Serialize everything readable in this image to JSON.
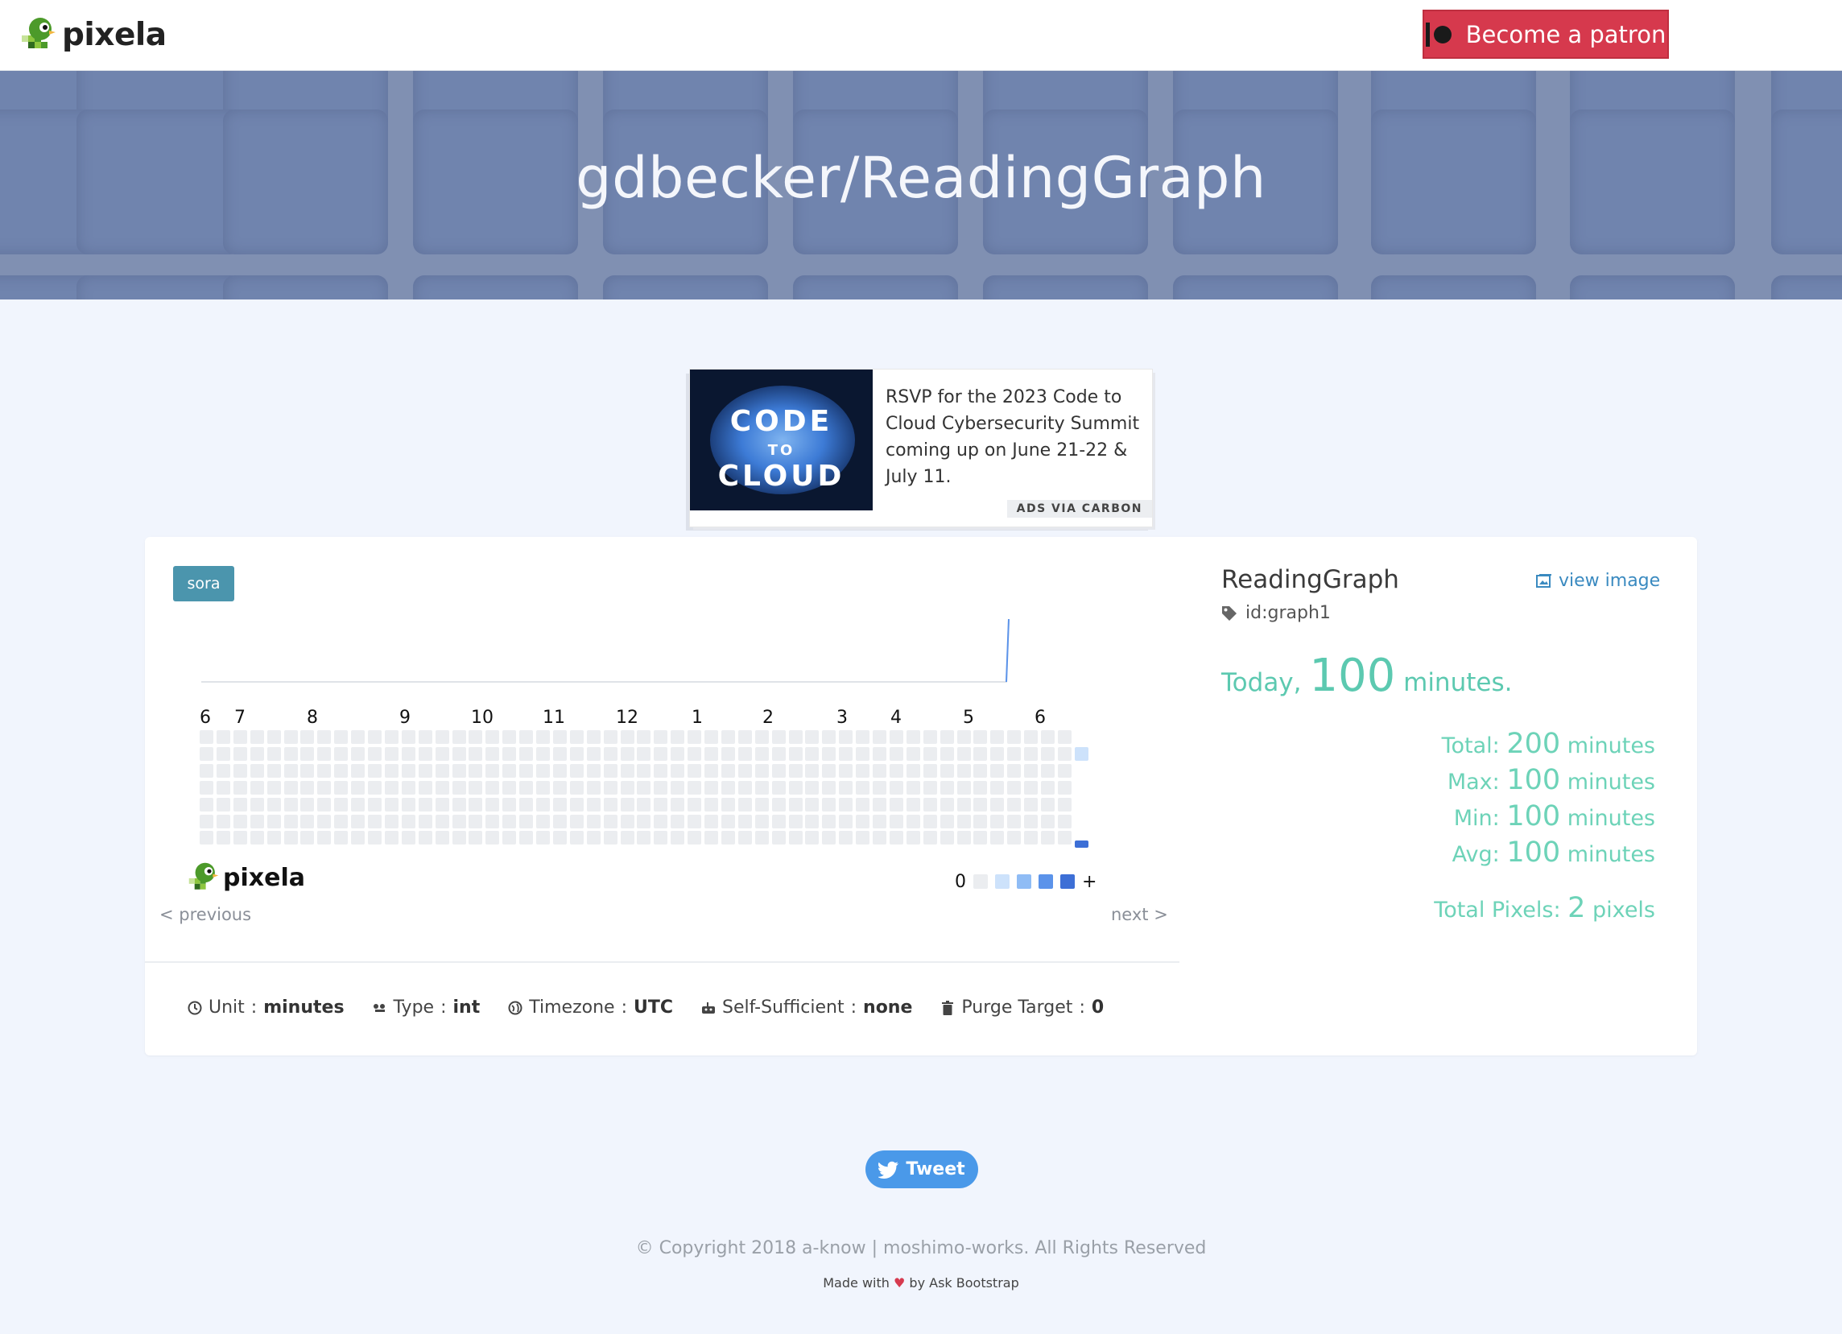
{
  "navbar": {
    "brand": "pixela",
    "patron_label": "Become a patron"
  },
  "hero": {
    "title": "gdbecker/ReadingGraph"
  },
  "ad": {
    "text": "RSVP for the 2023 Code to Cloud Cybersecurity Summit coming up on June 21-22 & July 11.",
    "image_line1": "CODE",
    "image_line2": "TO",
    "image_line3": "CLOUD",
    "via": "ADS VIA CARBON"
  },
  "graph": {
    "tag": "sora",
    "months": [
      "6",
      "7",
      "8",
      "9",
      "10",
      "11",
      "12",
      "1",
      "2",
      "3",
      "4",
      "5",
      "6"
    ],
    "logo_text": "pixela",
    "legend_min": "0",
    "legend_max": "+",
    "legend_colors": [
      "#ebedf0",
      "#cde2fb",
      "#8fbcf5",
      "#5b93ea",
      "#3d6fd6"
    ],
    "grid_color_empty": "#ebedf0",
    "pixels": [
      {
        "date": "latest-1",
        "color": "#cde2fb"
      },
      {
        "date": "latest",
        "color": "#3d6fd6"
      }
    ],
    "prev": "< previous",
    "next": "next >"
  },
  "meta": {
    "unit_label": "Unit",
    "unit_value": "minutes",
    "type_label": "Type",
    "type_value": "int",
    "tz_label": "Timezone",
    "tz_value": "UTC",
    "self_label": "Self-Sufficient",
    "self_value": "none",
    "purge_label": "Purge Target",
    "purge_value": "0",
    "sep": ":"
  },
  "info": {
    "name": "ReadingGraph",
    "id": "id:graph1",
    "view_image": "view image",
    "today_label": "Today",
    "today_value": "100",
    "today_unit": "minutes.",
    "stats": [
      {
        "label": "Total:",
        "value": "200",
        "unit": "minutes"
      },
      {
        "label": "Max:",
        "value": "100",
        "unit": "minutes"
      },
      {
        "label": "Min:",
        "value": "100",
        "unit": "minutes"
      },
      {
        "label": "Avg:",
        "value": "100",
        "unit": "minutes"
      }
    ],
    "total_pixels_label": "Total Pixels:",
    "total_pixels_value": "2",
    "total_pixels_unit": "pixels"
  },
  "footer": {
    "tweet": "Tweet",
    "copyright": "© Copyright 2018 a-know | moshimo-works. All Rights Reserved",
    "made_with_prefix": "Made with",
    "made_with_suffix": "by Ask Bootstrap"
  },
  "colors": {
    "accent_green": "#6dd3b8",
    "patron_red": "#d6394d",
    "tweet_blue": "#4a99e9",
    "tag_teal": "#4b95ad"
  }
}
